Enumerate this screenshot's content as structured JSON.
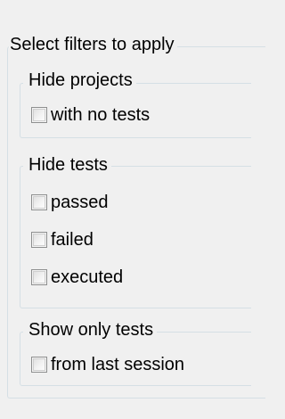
{
  "window": {
    "section_title": "Select filters to apply"
  },
  "groups": [
    {
      "title": "Hide projects",
      "options": [
        {
          "label": "with no tests",
          "checked": false
        }
      ]
    },
    {
      "title": "Hide tests",
      "options": [
        {
          "label": "passed",
          "checked": false
        },
        {
          "label": "failed",
          "checked": false
        },
        {
          "label": "executed",
          "checked": false
        }
      ]
    },
    {
      "title": "Show only tests",
      "options": [
        {
          "label": "from last session",
          "checked": false
        }
      ]
    }
  ]
}
